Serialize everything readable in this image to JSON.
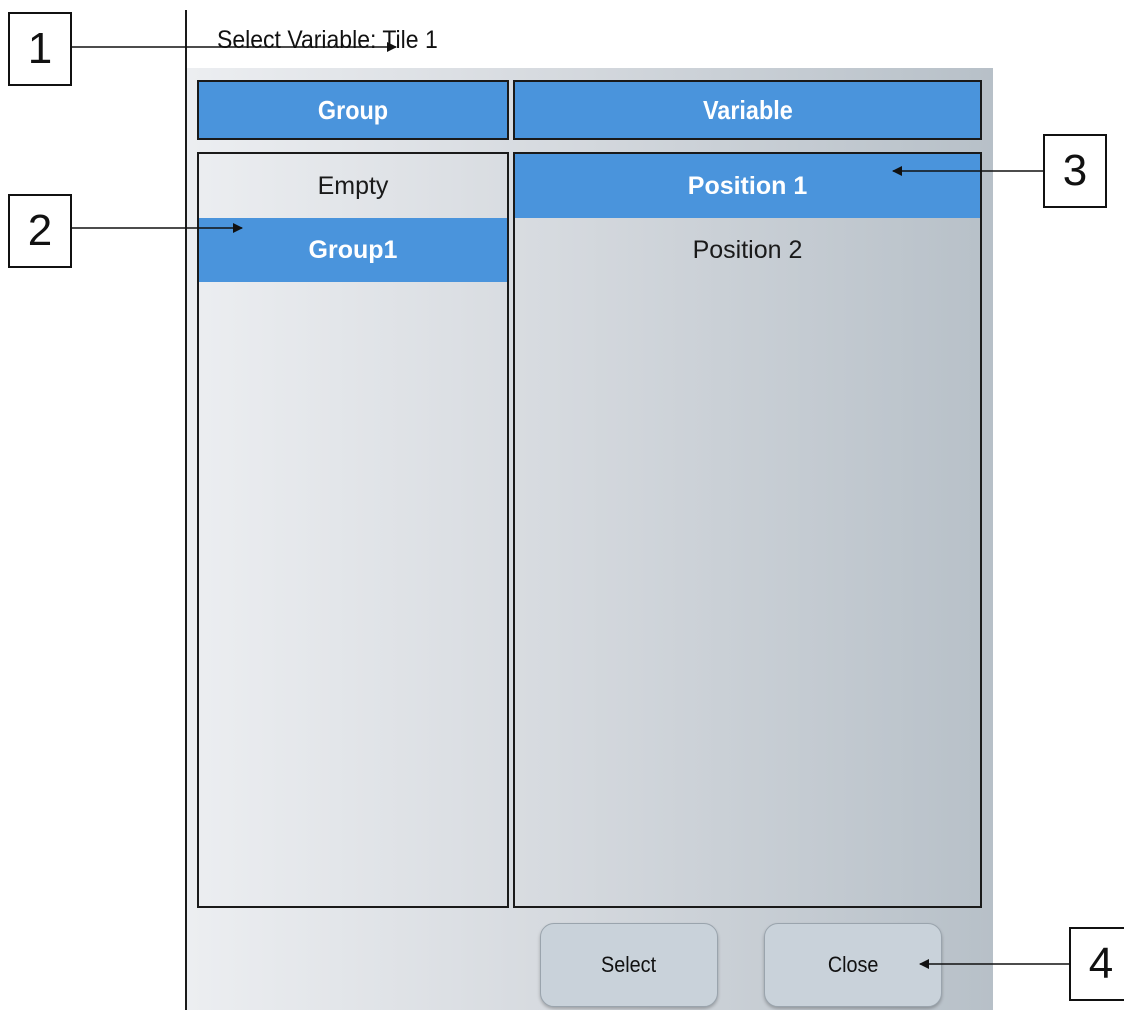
{
  "dialog": {
    "title": "Select Variable: Tile 1",
    "group_header": "Group",
    "variable_header": "Variable",
    "groups": [
      {
        "label": "Empty",
        "selected": false
      },
      {
        "label": "Group1",
        "selected": true
      }
    ],
    "variables": [
      {
        "label": "Position 1",
        "selected": true
      },
      {
        "label": "Position 2",
        "selected": false
      }
    ],
    "select_label": "Select",
    "close_label": "Close"
  },
  "callouts": [
    "1",
    "2",
    "3",
    "4"
  ],
  "colors": {
    "accent": "#4a94dc",
    "border": "#1a1a1a",
    "button": "#c9d2da"
  }
}
